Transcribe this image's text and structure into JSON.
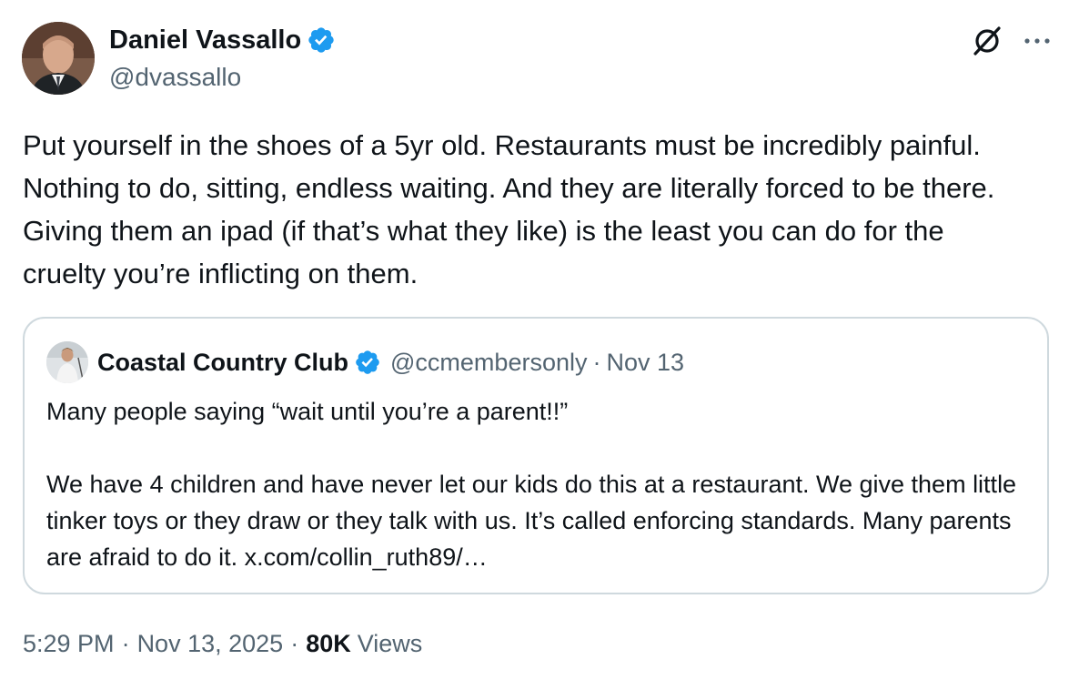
{
  "author": {
    "name": "Daniel Vassallo",
    "handle": "@dvassallo",
    "verified_color": "#1d9bf0"
  },
  "actions": {
    "grok_icon": "grok-icon",
    "more_icon": "more-icon"
  },
  "tweet": {
    "text": "Put yourself in the shoes of a 5yr old. Restaurants must be incredibly painful. Nothing to do, sitting, endless waiting. And they are literally forced to be there. Giving them an ipad (if that’s what they like) is the least you can do for the cruelty you’re inflicting on them."
  },
  "quote": {
    "name": "Coastal Country Club",
    "handle": "@ccmembersonly",
    "separator": "·",
    "date": "Nov 13",
    "line1": "Many people saying “wait until you’re a parent!!”",
    "line2": "We have 4 children and have never let our kids do this at a restaurant.  We give them little tinker toys or they draw or they talk with us.  It’s called enforcing standards.  Many parents are afraid to do it. x.com/collin_ruth89/…"
  },
  "meta": {
    "time": "5:29 PM",
    "separator": "·",
    "date": "Nov 13, 2025",
    "views_count": "80K",
    "views_label": "Views"
  }
}
